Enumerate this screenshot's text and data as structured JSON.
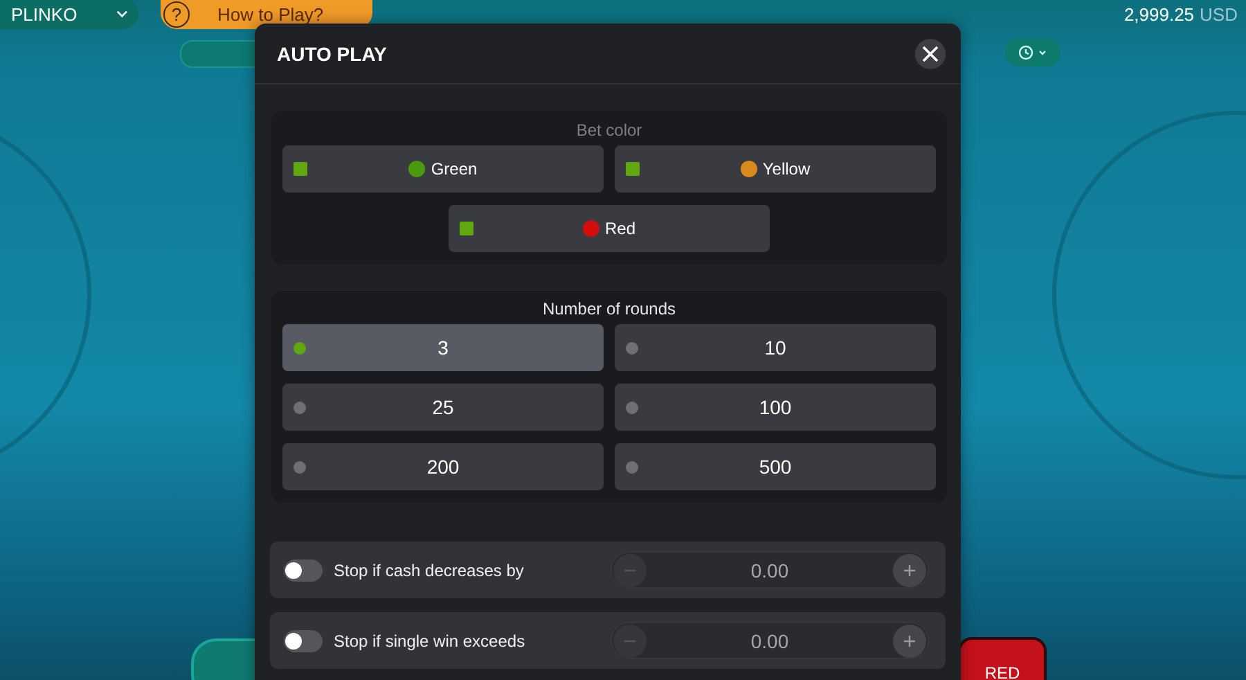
{
  "top_bar": {
    "game": "PLINKO",
    "help_icon": "?",
    "help": "How to Play?",
    "balance": "2,999.25",
    "currency": "USD"
  },
  "bet_button": {
    "label": "RED"
  },
  "modal": {
    "title": "AUTO PLAY",
    "bet_color": {
      "title": "Bet color",
      "options": [
        {
          "label": "Green",
          "color": "#4a9a10",
          "checked": true
        },
        {
          "label": "Yellow",
          "color": "#d98a1c",
          "checked": true
        },
        {
          "label": "Red",
          "color": "#d40d0d",
          "checked": true
        }
      ]
    },
    "rounds": {
      "title": "Number of rounds",
      "options": [
        {
          "label": "3",
          "selected": true
        },
        {
          "label": "10",
          "selected": false
        },
        {
          "label": "25",
          "selected": false
        },
        {
          "label": "100",
          "selected": false
        },
        {
          "label": "200",
          "selected": false
        },
        {
          "label": "500",
          "selected": false
        }
      ]
    },
    "stop_conditions": [
      {
        "label": "Stop if cash decreases by",
        "on": false,
        "value": "0.00"
      },
      {
        "label": "Stop if single win exceeds",
        "on": false,
        "value": "0.00"
      }
    ]
  }
}
